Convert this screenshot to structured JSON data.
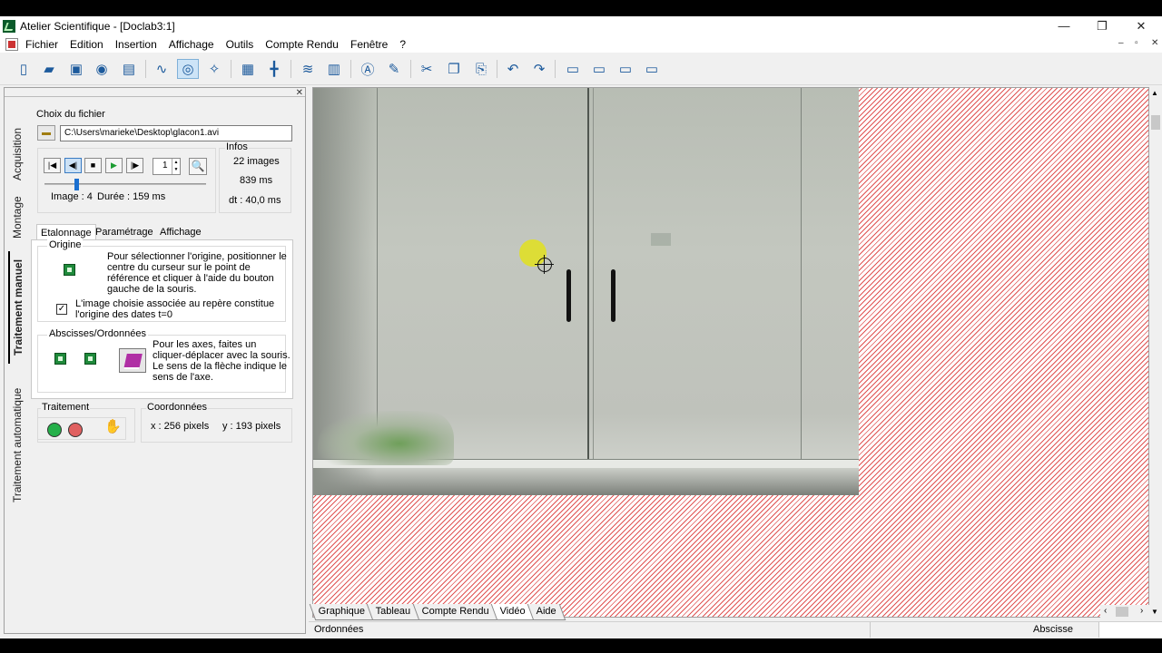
{
  "window": {
    "title": "Atelier Scientifique - [Doclab3:1]",
    "controls": {
      "minimize": "—",
      "maximize": "❐",
      "close": "✕"
    },
    "mdi_controls": {
      "minimize": "–",
      "restore": "▫",
      "close": "✕"
    }
  },
  "menu": [
    "Fichier",
    "Edition",
    "Insertion",
    "Affichage",
    "Outils",
    "Compte Rendu",
    "Fenêtre",
    "?"
  ],
  "toolbar_icons": [
    {
      "name": "new-icon",
      "glyph": "▯"
    },
    {
      "name": "open-icon",
      "glyph": "▰"
    },
    {
      "name": "save-icon",
      "glyph": "▣"
    },
    {
      "name": "export-icon",
      "glyph": "◉"
    },
    {
      "name": "print-icon",
      "glyph": "▤"
    },
    {
      "name": "curve-icon",
      "glyph": "∿"
    },
    {
      "name": "video-icon",
      "glyph": "◎"
    },
    {
      "name": "model-icon",
      "glyph": "✧"
    },
    {
      "name": "table-icon",
      "glyph": "▦"
    },
    {
      "name": "axes-icon",
      "glyph": "╋"
    },
    {
      "name": "data-icon",
      "glyph": "≋"
    },
    {
      "name": "list-icon",
      "glyph": "▥"
    },
    {
      "name": "text-icon",
      "glyph": "Ⓐ"
    },
    {
      "name": "tools-icon",
      "glyph": "✎"
    },
    {
      "name": "cut-icon",
      "glyph": "✂"
    },
    {
      "name": "copy-icon",
      "glyph": "❐"
    },
    {
      "name": "paste-icon",
      "glyph": "⎘"
    },
    {
      "name": "undo-icon",
      "glyph": "↶"
    },
    {
      "name": "redo-icon",
      "glyph": "↷"
    },
    {
      "name": "window1-icon",
      "glyph": "▭"
    },
    {
      "name": "window2-icon",
      "glyph": "▭"
    },
    {
      "name": "window3-icon",
      "glyph": "▭"
    },
    {
      "name": "window4-icon",
      "glyph": "▭"
    }
  ],
  "side_tabs": [
    "Acquisition",
    "Montage",
    "Traitement manuel",
    "Traitement automatique"
  ],
  "file": {
    "label": "Choix du fichier",
    "path": "C:\\Users\\marieke\\Desktop\\glacon1.avi"
  },
  "player": {
    "frame_value": "1",
    "image_text": "Image : 4",
    "duration_text": "Durée : 159 ms",
    "position_fraction": 0.19
  },
  "infos": {
    "label": "Infos",
    "images": "22 images",
    "duration": "839 ms",
    "dt": "dt : 40,0 ms"
  },
  "inner_tabs": [
    "Etalonnage",
    "Paramétrage",
    "Affichage"
  ],
  "origine": {
    "label": "Origine",
    "instructions": [
      "Pour sélectionner l'origine, positionner le",
      "centre du curseur sur le point de",
      "référence et cliquer à l'aide du bouton",
      "gauche de la souris."
    ],
    "checkbox_lines": [
      "L'image choisie associée au repère constitue",
      "l'origine des dates t=0"
    ],
    "checked": true
  },
  "axes": {
    "label": "Abscisses/Ordonnées",
    "instructions": [
      "Pour les axes, faites un",
      "cliquer-déplacer avec la souris.",
      "Le sens de la flèche indique le",
      "sens de l'axe."
    ]
  },
  "traitement": {
    "label": "Traitement"
  },
  "coordonnees": {
    "label": "Coordonnées",
    "x": "x : 256 pixels",
    "y": "y : 193 pixels"
  },
  "bottom_tabs": [
    "Graphique",
    "Tableau",
    "Compte Rendu",
    "Vidéo",
    "Aide"
  ],
  "active_bottom_tab": "Vidéo",
  "status": {
    "left": "Ordonnées",
    "right": "Abscisse"
  },
  "colors": {
    "hatch": "#e05353",
    "accent": "#1a6fd0",
    "green_button": "#25b04a",
    "red_button": "#e06060"
  }
}
